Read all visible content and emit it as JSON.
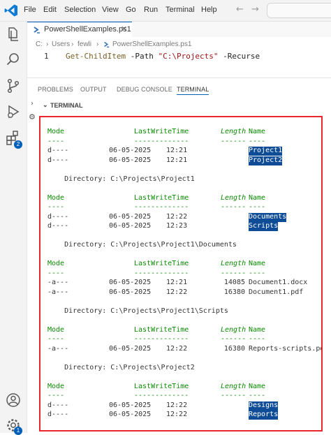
{
  "menu": {
    "items": [
      "File",
      "Edit",
      "Selection",
      "View",
      "Go",
      "Run",
      "Terminal",
      "Help"
    ],
    "back_icon": "arrow-left-icon",
    "forward_icon": "arrow-right-icon"
  },
  "activity_bar": {
    "icons": [
      "explorer-icon",
      "search-icon",
      "source-control-icon",
      "run-debug-icon",
      "extensions-icon",
      "account-icon",
      "settings-gear-icon"
    ],
    "extensions_badge": "2",
    "settings_badge": "1"
  },
  "editor": {
    "tab_label": "PowerShellExamples.ps1",
    "breadcrumb": [
      "C:",
      "Users",
      "fewli",
      "PowerShellExamples.ps1"
    ],
    "line_number": "1",
    "code": {
      "cmdlet": "Get-ChildItem",
      "param1": " -Path ",
      "string": "\"C:\\Projects\"",
      "param2": " -Recurse"
    }
  },
  "panel": {
    "tabs": [
      "PROBLEMS",
      "OUTPUT",
      "DEBUG CONSOLE",
      "TERMINAL"
    ],
    "active_tab": "TERMINAL",
    "section_title": "TERMINAL"
  },
  "terminal": {
    "col_mode": "Mode",
    "col_time": "LastWriteTime",
    "col_length": "Length",
    "col_name": "Name",
    "dash_mode": "----",
    "dash_time": "-------------",
    "dash_length": "------",
    "dash_name": "----",
    "blocks": [
      {
        "directory": "",
        "items": [
          {
            "mode": "d----",
            "date": "06-05-2025",
            "time": "12:21",
            "length": "",
            "name": "Project1",
            "highlight": true
          },
          {
            "mode": "d----",
            "date": "06-05-2025",
            "time": "12:21",
            "length": "",
            "name": "Project2",
            "highlight": true
          }
        ]
      },
      {
        "directory": "    Directory: C:\\Projects\\Project1",
        "items": [
          {
            "mode": "d----",
            "date": "06-05-2025",
            "time": "12:22",
            "length": "",
            "name": "Documents",
            "highlight": true
          },
          {
            "mode": "d----",
            "date": "06-05-2025",
            "time": "12:23",
            "length": "",
            "name": "Scripts",
            "highlight": true
          }
        ]
      },
      {
        "directory": "    Directory: C:\\Projects\\Project1\\Documents",
        "items": [
          {
            "mode": "-a---",
            "date": "06-05-2025",
            "time": "12:21",
            "length": "14085",
            "name": "Document1.docx",
            "highlight": false
          },
          {
            "mode": "-a---",
            "date": "06-05-2025",
            "time": "12:22",
            "length": "16380",
            "name": "Document1.pdf",
            "highlight": false
          }
        ]
      },
      {
        "directory": "    Directory: C:\\Projects\\Project1\\Scripts",
        "items": [
          {
            "mode": "-a---",
            "date": "06-05-2025",
            "time": "12:22",
            "length": "16380",
            "name": "Reports-scripts.pdf",
            "highlight": false
          }
        ]
      },
      {
        "directory": "    Directory: C:\\Projects\\Project2",
        "items": [
          {
            "mode": "d----",
            "date": "06-05-2025",
            "time": "12:22",
            "length": "",
            "name": "Designs",
            "highlight": true
          },
          {
            "mode": "d----",
            "date": "06-05-2025",
            "time": "12:22",
            "length": "",
            "name": "Reports",
            "highlight": true
          }
        ]
      }
    ]
  },
  "colors": {
    "accent": "#005fb8",
    "terminal_header": "#0a8a00",
    "highlight": "#0f4c97",
    "frame": "#e8262b"
  }
}
